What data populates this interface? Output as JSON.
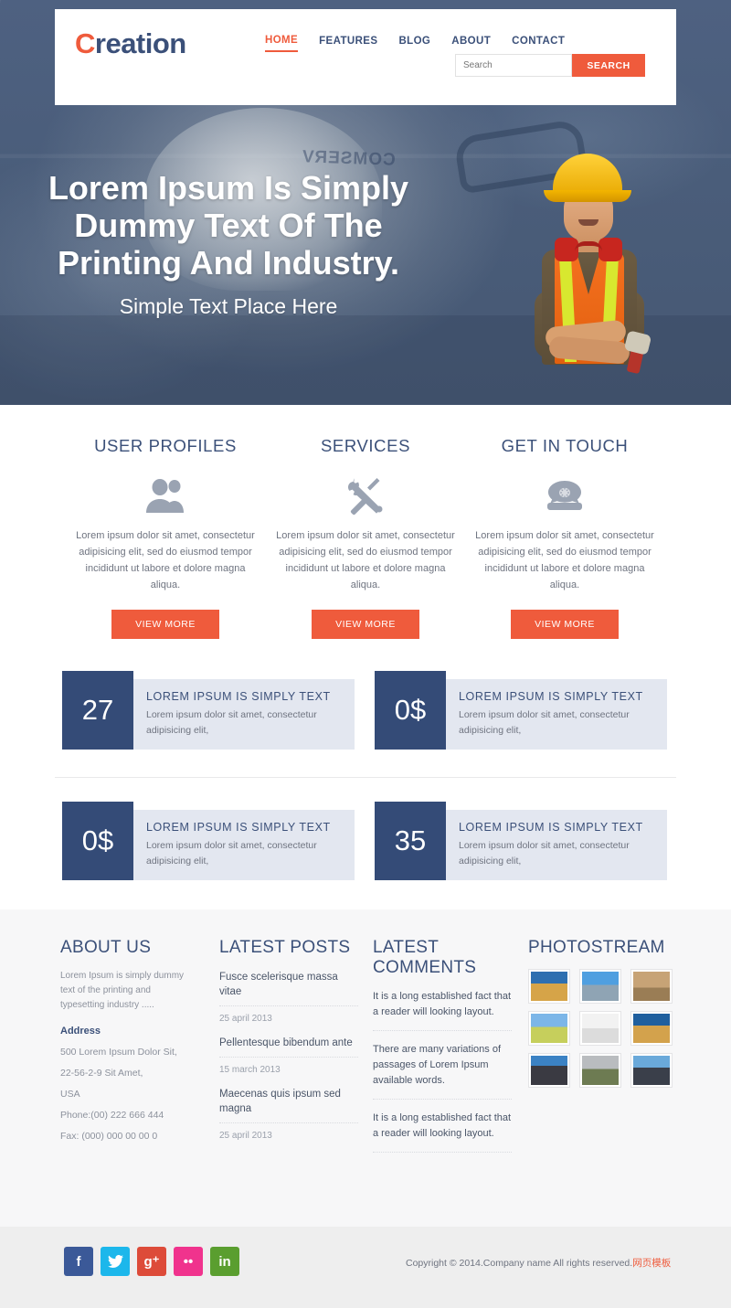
{
  "header": {
    "logo_c": "C",
    "logo_rest": "reation",
    "nav": [
      {
        "label": "HOME",
        "active": true
      },
      {
        "label": "FEATURES",
        "active": false
      },
      {
        "label": "BLOG",
        "active": false
      },
      {
        "label": "ABOUT",
        "active": false
      },
      {
        "label": "CONTACT",
        "active": false
      }
    ],
    "search": {
      "placeholder": "Search",
      "value": "",
      "button_label": "SEARCH"
    }
  },
  "hero": {
    "title": "Lorem Ipsum Is Simply Dummy Text Of The Printing And Industry.",
    "subtitle": "Simple Text Place Here",
    "bg_helmet_text": "COMSERV",
    "overlay_color": "#4a5d7a"
  },
  "features": [
    {
      "title": "USER PROFILES",
      "icon": "users-icon",
      "desc": "Lorem ipsum dolor sit amet, consectetur adipisicing elit, sed do eiusmod tempor incididunt ut labore et dolore magna aliqua.",
      "button": "VIEW MORE"
    },
    {
      "title": "SERVICES",
      "icon": "tools-icon",
      "desc": "Lorem ipsum dolor sit amet, consectetur adipisicing elit, sed do eiusmod tempor incididunt ut labore et dolore magna aliqua.",
      "button": "VIEW MORE"
    },
    {
      "title": "GET IN TOUCH",
      "icon": "telephone-icon",
      "desc": "Lorem ipsum dolor sit amet, consectetur adipisicing elit, sed do eiusmod tempor incididunt ut labore et dolore magna aliqua.",
      "button": "VIEW MORE"
    }
  ],
  "stats": [
    {
      "number": "27",
      "heading": "LOREM IPSUM IS SIMPLY TEXT",
      "desc": "Lorem ipsum dolor sit amet, consectetur adipisicing elit,"
    },
    {
      "number": "0$",
      "heading": "LOREM IPSUM IS SIMPLY TEXT",
      "desc": "Lorem ipsum dolor sit amet, consectetur adipisicing elit,"
    },
    {
      "number": "0$",
      "heading": "LOREM IPSUM IS SIMPLY TEXT",
      "desc": "Lorem ipsum dolor sit amet, consectetur adipisicing elit,"
    },
    {
      "number": "35",
      "heading": "LOREM IPSUM IS SIMPLY TEXT",
      "desc": "Lorem ipsum dolor sit amet, consectetur adipisicing elit,"
    }
  ],
  "footer": {
    "about": {
      "title": "ABOUT US",
      "paragraph": "Lorem Ipsum is simply dummy text of the printing and typesetting industry .....",
      "address_heading": "Address",
      "lines": [
        "500 Lorem Ipsum Dolor Sit,",
        "22-56-2-9 Sit Amet,",
        "USA",
        "Phone:(00) 222 666 444",
        "Fax: (000) 000 00 00 0"
      ]
    },
    "posts": {
      "title": "LATEST POSTS",
      "items": [
        {
          "title": "Fusce scelerisque massa vitae",
          "date": "25 april 2013"
        },
        {
          "title": "Pellentesque bibendum ante",
          "date": "15 march 2013"
        },
        {
          "title": "Maecenas quis ipsum sed magna",
          "date": "25 april 2013"
        }
      ]
    },
    "comments": {
      "title": "LATEST COMMENTS",
      "items": [
        "It is a long established fact that a reader will looking layout.",
        "There are many variations of passages of Lorem Ipsum available words.",
        "It is a long established fact that a reader will looking layout."
      ]
    },
    "photostream": {
      "title": "PHOTOSTREAM",
      "count": 9
    }
  },
  "bottom": {
    "socials": [
      {
        "name": "facebook",
        "glyph": "f"
      },
      {
        "name": "twitter",
        "glyph": ""
      },
      {
        "name": "google-plus",
        "glyph": "g⁺"
      },
      {
        "name": "flickr",
        "glyph": "••"
      },
      {
        "name": "linkedin",
        "glyph": "in"
      }
    ],
    "copyright": "Copyright © 2014.Company name All rights reserved.",
    "copyright_cn": "网页模板"
  },
  "colors": {
    "accent_orange": "#ef5b3c",
    "navy": "#344b77",
    "hero_blue": "#4a5d7a",
    "stat_body": "#e3e7f0",
    "footer_bg": "#f7f7f8",
    "bottombar_bg": "#eeeeee"
  }
}
